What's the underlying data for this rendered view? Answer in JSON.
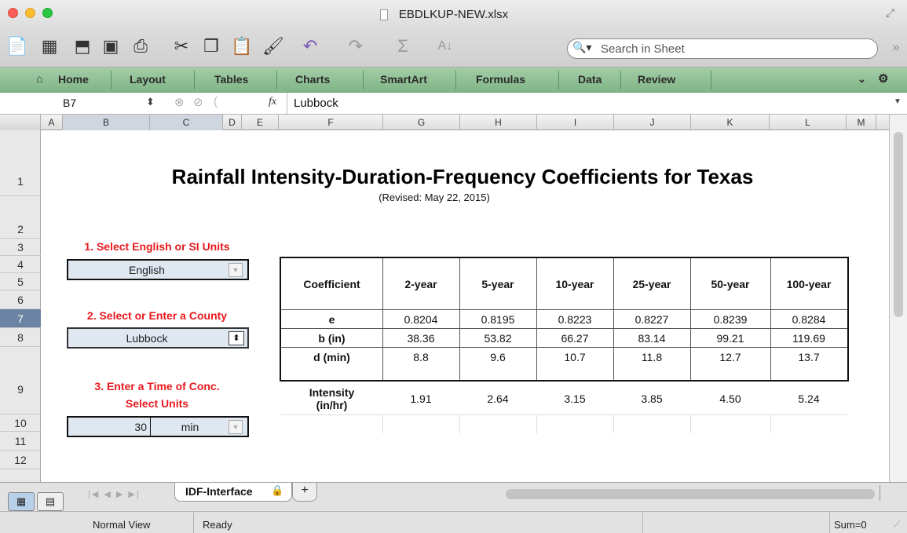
{
  "window": {
    "title": "EBDLKUP-NEW.xlsx"
  },
  "search": {
    "placeholder": "Search in Sheet"
  },
  "ribbon": {
    "tabs": [
      "Home",
      "Layout",
      "Tables",
      "Charts",
      "SmartArt",
      "Formulas",
      "Data",
      "Review"
    ]
  },
  "formula_bar": {
    "cell_ref": "B7",
    "fx": "fx",
    "value": "Lubbock"
  },
  "columns": [
    "A",
    "B",
    "C",
    "D",
    "E",
    "F",
    "G",
    "H",
    "I",
    "J",
    "K",
    "L",
    "M"
  ],
  "rows": [
    "1",
    "2",
    "3",
    "4",
    "5",
    "6",
    "7",
    "8",
    "9",
    "10",
    "11",
    "12"
  ],
  "sheet": {
    "title": "Rainfall Intensity-Duration-Frequency Coefficients for Texas",
    "subtitle": "(Revised: May 22, 2015)",
    "step1_label": "1. Select English or SI Units",
    "units_value": "English",
    "step2_label": "2. Select or Enter a County",
    "county_value": "Lubbock",
    "step3_label": "3. Enter a Time of Conc.",
    "step3_sub": "Select Units",
    "time_value": "30",
    "time_unit": "min"
  },
  "table": {
    "header": [
      "Coefficient",
      "2-year",
      "5-year",
      "10-year",
      "25-year",
      "50-year",
      "100-year"
    ],
    "rows": [
      [
        "e",
        "0.8204",
        "0.8195",
        "0.8223",
        "0.8227",
        "0.8239",
        "0.8284"
      ],
      [
        "b (in)",
        "38.36",
        "53.82",
        "66.27",
        "83.14",
        "99.21",
        "119.69"
      ],
      [
        "d (min)",
        "8.8",
        "9.6",
        "10.7",
        "11.8",
        "12.7",
        "13.7"
      ]
    ],
    "intensity_label": "Intensity (in/hr)",
    "intensity": [
      "1.91",
      "2.64",
      "3.15",
      "3.85",
      "4.50",
      "5.24"
    ]
  },
  "sheet_tab": {
    "name": "IDF-Interface",
    "add": "+"
  },
  "status": {
    "view": "Normal View",
    "state": "Ready",
    "sum": "Sum=0"
  },
  "colors": {
    "accent_red": "#e8191e",
    "ribbon_green": "#8fc096",
    "control_fill": "#dfe7f1"
  }
}
